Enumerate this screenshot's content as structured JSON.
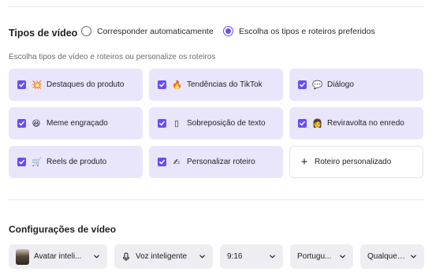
{
  "video_types": {
    "title": "Tipos de vídeo",
    "radio_options": [
      {
        "label": "Corresponder automaticamente",
        "selected": false
      },
      {
        "label": "Escolha os tipos e roteiros preferidos",
        "selected": true
      }
    ],
    "hint": "Escolha tipos de vídeo e roteiros ou personalize os roteiros",
    "cards": [
      {
        "label": "Destaques do produto",
        "emoji": "💥",
        "icon": "burst-icon",
        "checked": true
      },
      {
        "label": "Tendências do TikTok",
        "emoji": "🔥",
        "icon": "fire-icon",
        "checked": true
      },
      {
        "label": "Diálogo",
        "emoji": "💬",
        "icon": "speech-bubble-icon",
        "checked": true
      },
      {
        "label": "Meme engraçado",
        "emoji": "😆",
        "icon": "laughing-face-icon",
        "checked": true
      },
      {
        "label": "Sobreposição de texto",
        "emoji": "▯",
        "icon": "text-overlay-icon",
        "checked": true
      },
      {
        "label": "Reviravolta no enredo",
        "emoji": "👩",
        "icon": "person-icon",
        "checked": true
      },
      {
        "label": "Reels de produto",
        "emoji": "🛒",
        "icon": "cart-icon",
        "checked": true
      },
      {
        "label": "Personalizar roteiro",
        "emoji": "✍",
        "icon": "writing-hand-icon",
        "checked": true
      },
      {
        "label": "Roteiro personalizado",
        "emoji": "+",
        "icon": "plus-icon",
        "checked": false
      }
    ]
  },
  "video_settings": {
    "title": "Configurações de vídeo",
    "dropdowns": [
      {
        "label": "Avatar inteli...",
        "icon": "avatar-thumbnail"
      },
      {
        "label": "Voz inteligente",
        "icon": "microphone-icon"
      },
      {
        "label": "9:16",
        "icon": ""
      },
      {
        "label": "Portugu...",
        "icon": ""
      },
      {
        "label": "Qualquer d",
        "icon": ""
      }
    ]
  },
  "colors": {
    "accent": "#6a4cf5",
    "card_bg": "#e9e6fc",
    "dropdown_bg": "#eeeef2"
  }
}
